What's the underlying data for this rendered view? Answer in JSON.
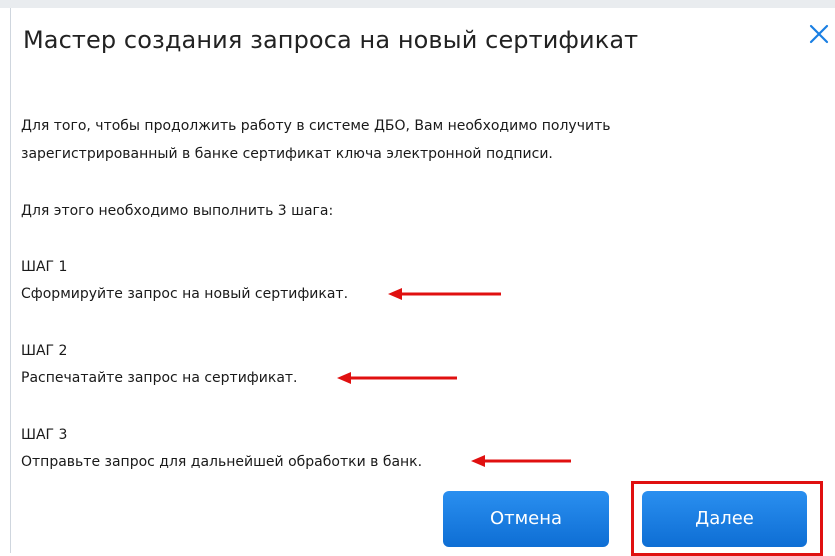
{
  "dialog": {
    "title": "Мастер создания запроса на новый сертификат",
    "close_icon": "close-icon",
    "intro_line1": "Для того, чтобы продолжить работу в системе ДБО, Вам необходимо получить",
    "intro_line2": "зарегистрированный в банке сертификат ключа электронной подписи.",
    "steps_intro": "Для этого необходимо выполнить 3 шага:",
    "steps": [
      {
        "label": "ШАГ 1",
        "text": "Сформируйте запрос на новый сертификат."
      },
      {
        "label": "ШАГ 2",
        "text": "Распечатайте запрос на сертификат."
      },
      {
        "label": "ШАГ 3",
        "text": "Отправьте запрос для дальнейшей обработки в банк."
      }
    ],
    "buttons": {
      "cancel": "Отмена",
      "next": "Далее"
    }
  },
  "colors": {
    "accent": "#1a7fe3",
    "annotation": "#e01010"
  }
}
